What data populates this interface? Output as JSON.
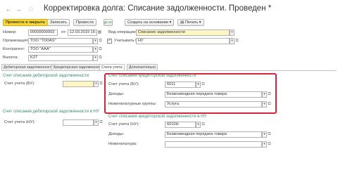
{
  "window": {
    "title": "Корректировка долга: Списание задолженности. Проведен *"
  },
  "toolbar": {
    "post_close": "Провести и закрыть",
    "save": "Записать",
    "post": "Провести",
    "create_based": "Создать на основании",
    "print": "Печать"
  },
  "header": {
    "number_label": "Номер:",
    "number_value": "00000000003",
    "date_label": "от:",
    "date_value": "12.03.2019 15:36:2",
    "operation_label": "Вид операции:",
    "operation_value": "Списание задолженности",
    "org_label": "Организация:",
    "org_value": "ТОО \"ТООАS\"",
    "kpn_label": "Учитывать КПН:",
    "kpn_value": "НУ",
    "counterparty_label": "Контрагент:",
    "counterparty_value": "ТОО \"ААА\"",
    "currency_label": "Валюта:",
    "currency_value": "KZT"
  },
  "tabs": [
    {
      "label": "Дебиторская задолженность"
    },
    {
      "label": "Кредиторская задолженность"
    },
    {
      "label": "Счета учета"
    },
    {
      "label": "Дополнительно"
    }
  ],
  "left_top": {
    "heading": "Счет списания дебиторской задолженности",
    "account_label": "Счет учета (БУ):",
    "account_value": ""
  },
  "right_top": {
    "heading": "Счет списания кредиторской задолженности",
    "account_label": "Счет учета (БУ):",
    "account_value": "6011",
    "income_label": "Доходы:",
    "income_value": "Безвозмездная передача товара",
    "nomen_label": "Номенклатурные группы:",
    "nomen_value": "Услуга"
  },
  "left_bottom": {
    "heading": "Счет списания дебиторской задолженности в НУ",
    "account_label": "Счет учета (НУ):",
    "account_value": ""
  },
  "right_bottom": {
    "heading": "Счет списания кредиторской задолженности в НУ",
    "account_label": "Счет учета (НУ):",
    "account_value": "6010Н",
    "income_label": "Доходы:",
    "income_value": "Безвозмездная передача товара",
    "nomen_label": "Номенклатура:",
    "nomen_value": ""
  },
  "colors": {
    "primary_button": "#fcd82e",
    "section_heading": "#3d8a74",
    "highlight": "#d6243a",
    "required_field": "#fdf5c4"
  }
}
